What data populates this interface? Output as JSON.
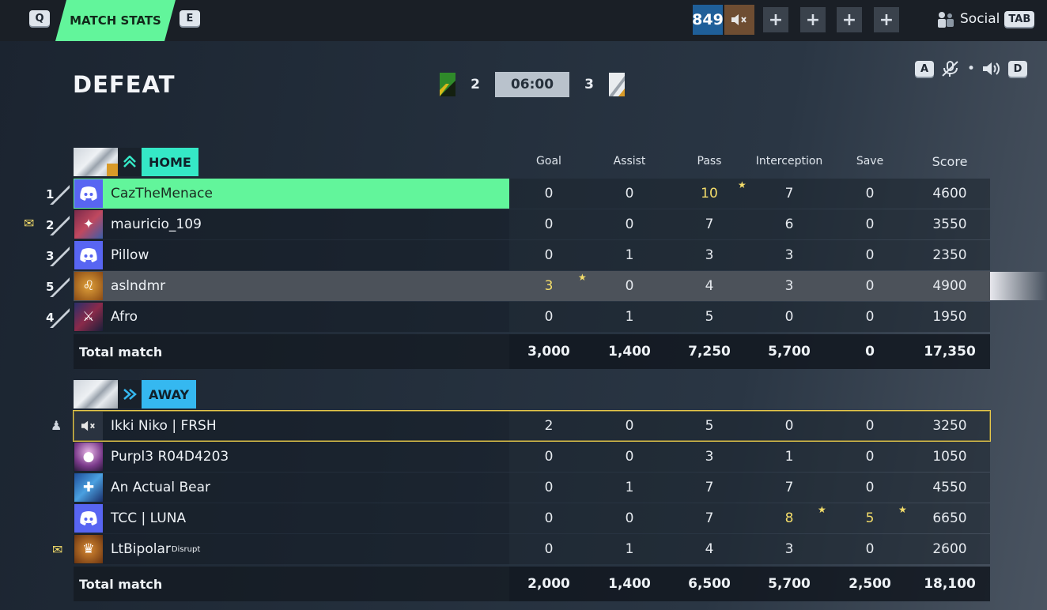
{
  "topbar": {
    "key_prev": "Q",
    "tab_label": "MATCH STATS",
    "key_next": "E",
    "currency": "849",
    "profile_icon": "muted-speaker-icon",
    "social_label": "Social",
    "social_key": "TAB"
  },
  "result": "DEFEAT",
  "scoreboard": {
    "home_score": "2",
    "timer": "06:00",
    "away_score": "3"
  },
  "audio": {
    "key_left": "A",
    "key_right": "D"
  },
  "columns": [
    "Goal",
    "Assist",
    "Pass",
    "Interception",
    "Save",
    "Score"
  ],
  "home": {
    "label": "HOME",
    "color": "#35e8c6",
    "players": [
      {
        "rank": "1",
        "name": "CazTheMenace",
        "avatar": "discord-icon",
        "stats": [
          "0",
          "0",
          "10",
          "7",
          "0",
          "4600"
        ]
      },
      {
        "rank": "2",
        "name": "mauricio_109",
        "avatar": "creature-avatar",
        "stats": [
          "0",
          "0",
          "7",
          "6",
          "0",
          "3550"
        ]
      },
      {
        "rank": "3",
        "name": "Pillow",
        "avatar": "discord-icon",
        "stats": [
          "0",
          "1",
          "3",
          "3",
          "0",
          "2350"
        ]
      },
      {
        "rank": "5",
        "name": "aslndmr",
        "avatar": "lion-avatar",
        "stats": [
          "3",
          "0",
          "4",
          "3",
          "0",
          "4900"
        ]
      },
      {
        "rank": "4",
        "name": "Afro",
        "avatar": "warrior-avatar",
        "stats": [
          "0",
          "1",
          "5",
          "0",
          "0",
          "1950"
        ]
      }
    ],
    "totals_label": "Total match",
    "totals": [
      "3,000",
      "1,400",
      "7,250",
      "5,700",
      "0",
      "17,350"
    ]
  },
  "away": {
    "label": "AWAY",
    "color": "#35b8f0",
    "players": [
      {
        "name": "Ikki Niko | FRSH",
        "avatar": "muted-speaker-icon",
        "stats": [
          "2",
          "0",
          "5",
          "0",
          "0",
          "3250"
        ]
      },
      {
        "name": "Purpl3 R04D4203",
        "avatar": "purple-orb-avatar",
        "stats": [
          "0",
          "0",
          "3",
          "1",
          "0",
          "1050"
        ]
      },
      {
        "name": "An Actual Bear",
        "avatar": "bear-avatar",
        "stats": [
          "0",
          "1",
          "7",
          "7",
          "0",
          "4550"
        ]
      },
      {
        "name": "TCC | LUNA",
        "avatar": "discord-icon",
        "stats": [
          "0",
          "0",
          "7",
          "8",
          "5",
          "6650"
        ]
      },
      {
        "name": "LtBipolar",
        "tag": "Disrupt",
        "avatar": "orange-avatar",
        "stats": [
          "0",
          "1",
          "4",
          "3",
          "0",
          "2600"
        ]
      }
    ],
    "totals_label": "Total match",
    "totals": [
      "2,000",
      "1,400",
      "6,500",
      "5,700",
      "2,500",
      "18,100"
    ]
  }
}
